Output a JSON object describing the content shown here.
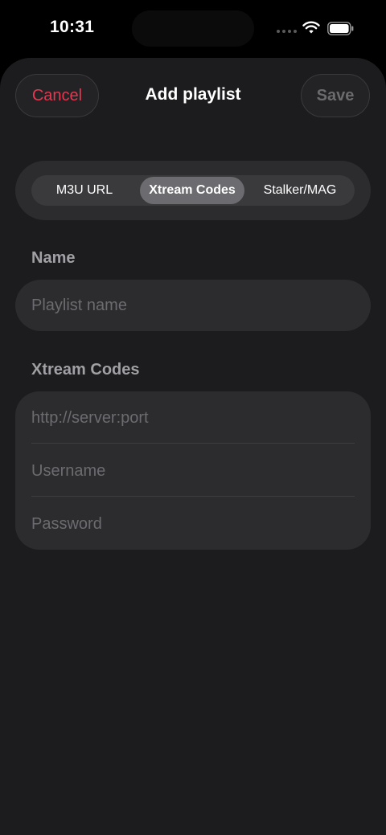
{
  "status_bar": {
    "time": "10:31"
  },
  "header": {
    "cancel_label": "Cancel",
    "title": "Add playlist",
    "save_label": "Save"
  },
  "segments": {
    "items": [
      "M3U URL",
      "Xtream Codes",
      "Stalker/MAG"
    ],
    "selected": "Xtream Codes"
  },
  "name_section": {
    "label": "Name",
    "placeholder": "Playlist name"
  },
  "xtream_section": {
    "label": "Xtream Codes",
    "server_placeholder": "http://server:port",
    "username_placeholder": "Username",
    "password_placeholder": "Password"
  },
  "colors": {
    "accent_cancel": "#e5374f",
    "background": "#1c1c1e",
    "card": "#2c2c2e",
    "segment_active": "#6c6c70"
  },
  "icons": [
    "cellular-signal-icon",
    "wifi-icon",
    "battery-icon"
  ]
}
